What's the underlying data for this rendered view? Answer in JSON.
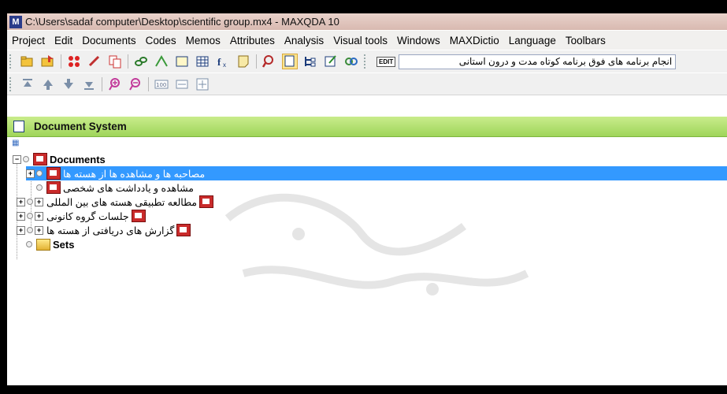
{
  "window": {
    "title": "C:\\Users\\sadaf computer\\Desktop\\scientific group.mx4 - MAXQDA 10",
    "app_icon_letter": "M"
  },
  "menu": [
    "Project",
    "Edit",
    "Documents",
    "Codes",
    "Memos",
    "Attributes",
    "Analysis",
    "Visual tools",
    "Windows",
    "MAXDictio",
    "Language",
    "Toolbars"
  ],
  "toolbar": {
    "edit_badge": "EDIT",
    "selected_document": "انجام برنامه های فوق برنامه کوتاه مدت و درون استانی"
  },
  "panel": {
    "title": "Document System"
  },
  "tree": {
    "root_label": "Documents",
    "groups": [
      {
        "label": "مصاحبه ها و مشاهده ها از هسته ها",
        "selected": true
      },
      {
        "label": "مشاهده و یادداشت های شخصی",
        "selected": false
      },
      {
        "label": "مطالعه تطبیقی هسته های بین المللی",
        "selected": false
      },
      {
        "label": "جلسات گروه کانونی",
        "selected": false
      },
      {
        "label": "گزارش های دریافتی از هسته ها",
        "selected": false
      }
    ],
    "sets_label": "Sets"
  },
  "colors": {
    "selection": "#3399ff",
    "panel_header": "#9fd55a",
    "document_icon": "#c92b2b"
  }
}
